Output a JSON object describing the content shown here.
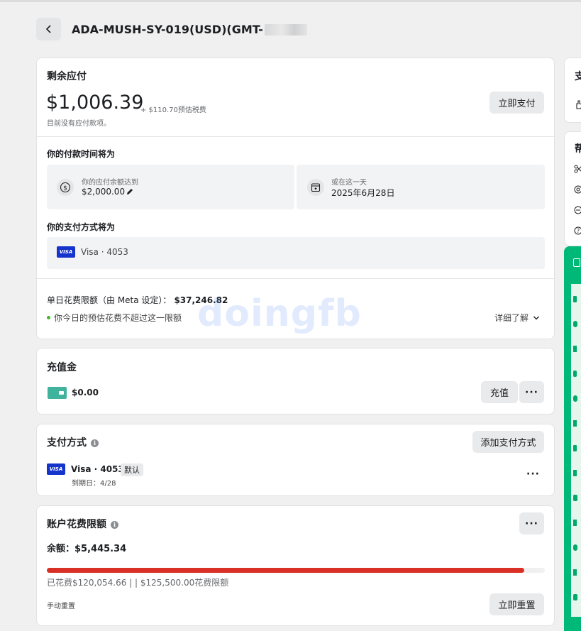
{
  "header": {
    "title": "ADA-MUSH-SY-019(USD)(GMT-"
  },
  "balance": {
    "title": "剩余应付",
    "amount": "$1,006.39",
    "tax_note": "+ $110.70预估税费",
    "sub_note": "目前没有应付款项。",
    "pay_now_label": "立即支付"
  },
  "schedule": {
    "title": "你的付款时间将为",
    "threshold_caption": "你的应付余额达到",
    "threshold_value": "$2,000.00",
    "date_caption": "或在这一天",
    "date_value": "2025年6月28日"
  },
  "method_preview": {
    "title": "你的支付方式将为",
    "card_brand": "VISA",
    "card_text": "Visa · 4053"
  },
  "daily_limit": {
    "label": "单日花费限额（由 Meta 设定）：",
    "value": "$37,246.82",
    "note": "你今日的预估花费不超过这一限额",
    "learn_more": "详细了解"
  },
  "watermark": "doingfb",
  "prepaid": {
    "title": "充值金",
    "amount": "$0.00",
    "recharge_label": "充值",
    "more": "···"
  },
  "payment_methods": {
    "title": "支付方式",
    "add_label": "添加支付方式",
    "card_brand": "VISA",
    "card_text": "Visa · 4053",
    "default_badge": "默认",
    "expiry": "到期日：4/28",
    "more": "···"
  },
  "spending_limit": {
    "title": "账户花费限额",
    "remaining": "余额：$5,445.34",
    "progress_fraction": 0.959,
    "summary": "已花费$120,054.66 | | $125,500.00花费限额",
    "manual_reset": "手动重置",
    "reset_now_label": "立即重置",
    "more": "···",
    "bar_color": "#d93025"
  },
  "right_panel": {
    "top_char": "支",
    "help_char": "帮"
  },
  "colors": {
    "accent_green": "#00b877",
    "visa_blue": "#1434cb",
    "progress_red": "#d93025"
  }
}
